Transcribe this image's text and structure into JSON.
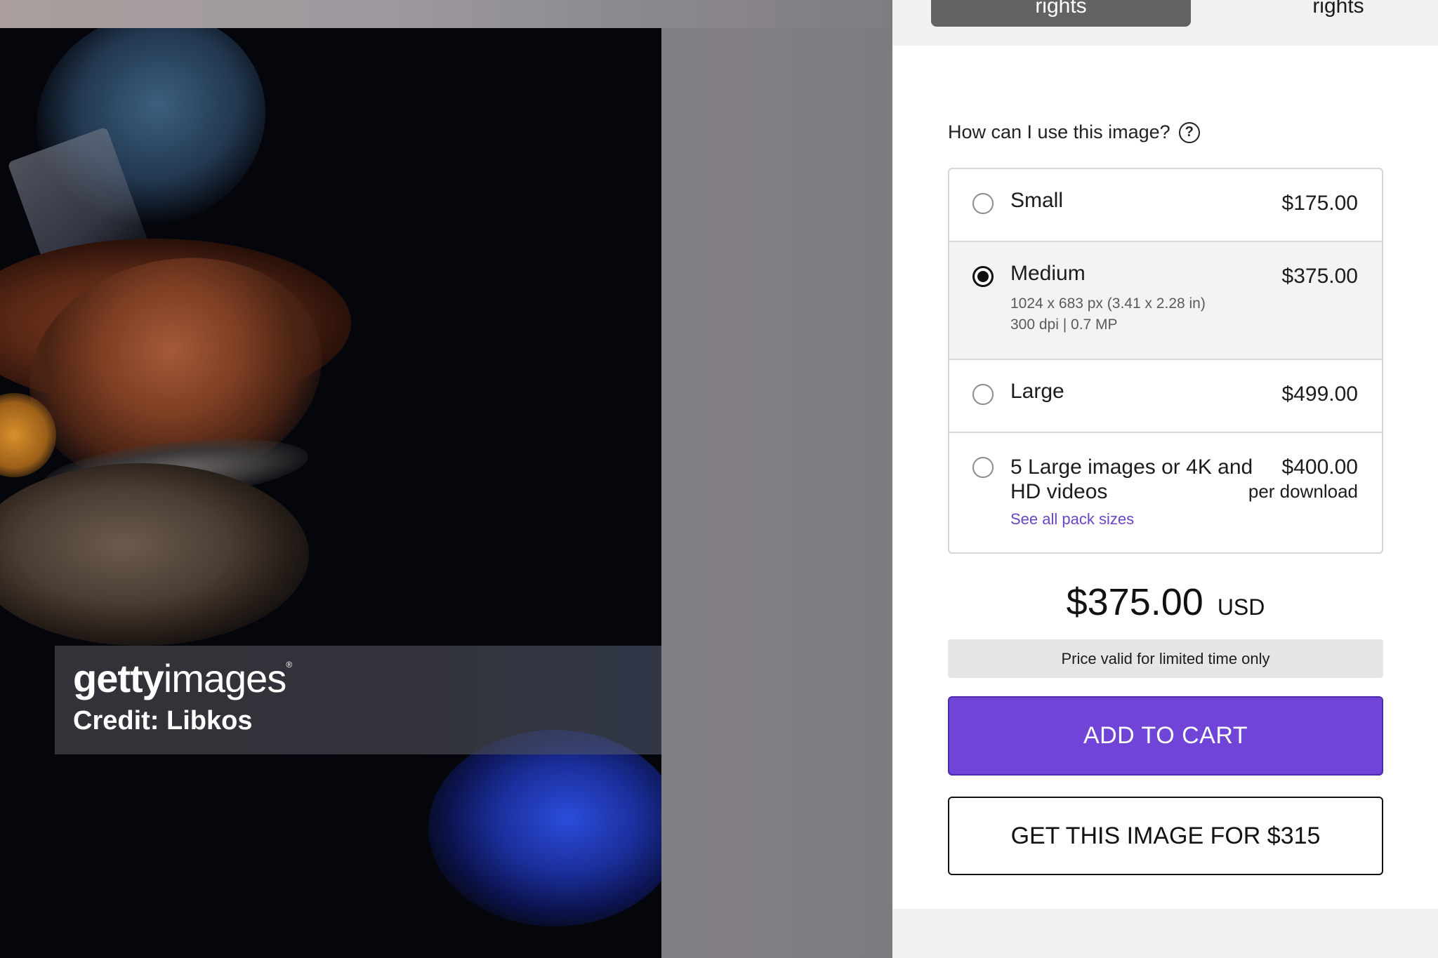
{
  "preview": {
    "brand_bold": "getty",
    "brand_light": "images",
    "brand_mark": "®",
    "credit": "Credit: Libkos"
  },
  "tabs": [
    {
      "label": "rights",
      "active": true
    },
    {
      "label": "rights",
      "active": false
    }
  ],
  "usage": {
    "question": "How can I use this image?",
    "help_icon": "?"
  },
  "options": [
    {
      "name": "Small",
      "price": "$175.00",
      "selected": false
    },
    {
      "name": "Medium",
      "price": "$375.00",
      "selected": true,
      "detail_1": "1024 x 683 px (3.41 x 2.28 in)",
      "detail_2": "300 dpi | 0.7 MP"
    },
    {
      "name": "Large",
      "price": "$499.00",
      "selected": false
    },
    {
      "name_1": "5 Large images or 4K and",
      "name_2": "HD videos",
      "price": "$400.00",
      "per": "per download",
      "link": "See all pack sizes",
      "selected": false
    }
  ],
  "total": {
    "amount": "$375.00",
    "currency": "USD",
    "note": "Price valid for limited time only"
  },
  "actions": {
    "add_to_cart": "ADD TO CART",
    "get_image": "GET THIS IMAGE FOR $315"
  },
  "colors": {
    "accent": "#6f44d6",
    "link": "#6a45c9",
    "active_tab": "#626262"
  }
}
